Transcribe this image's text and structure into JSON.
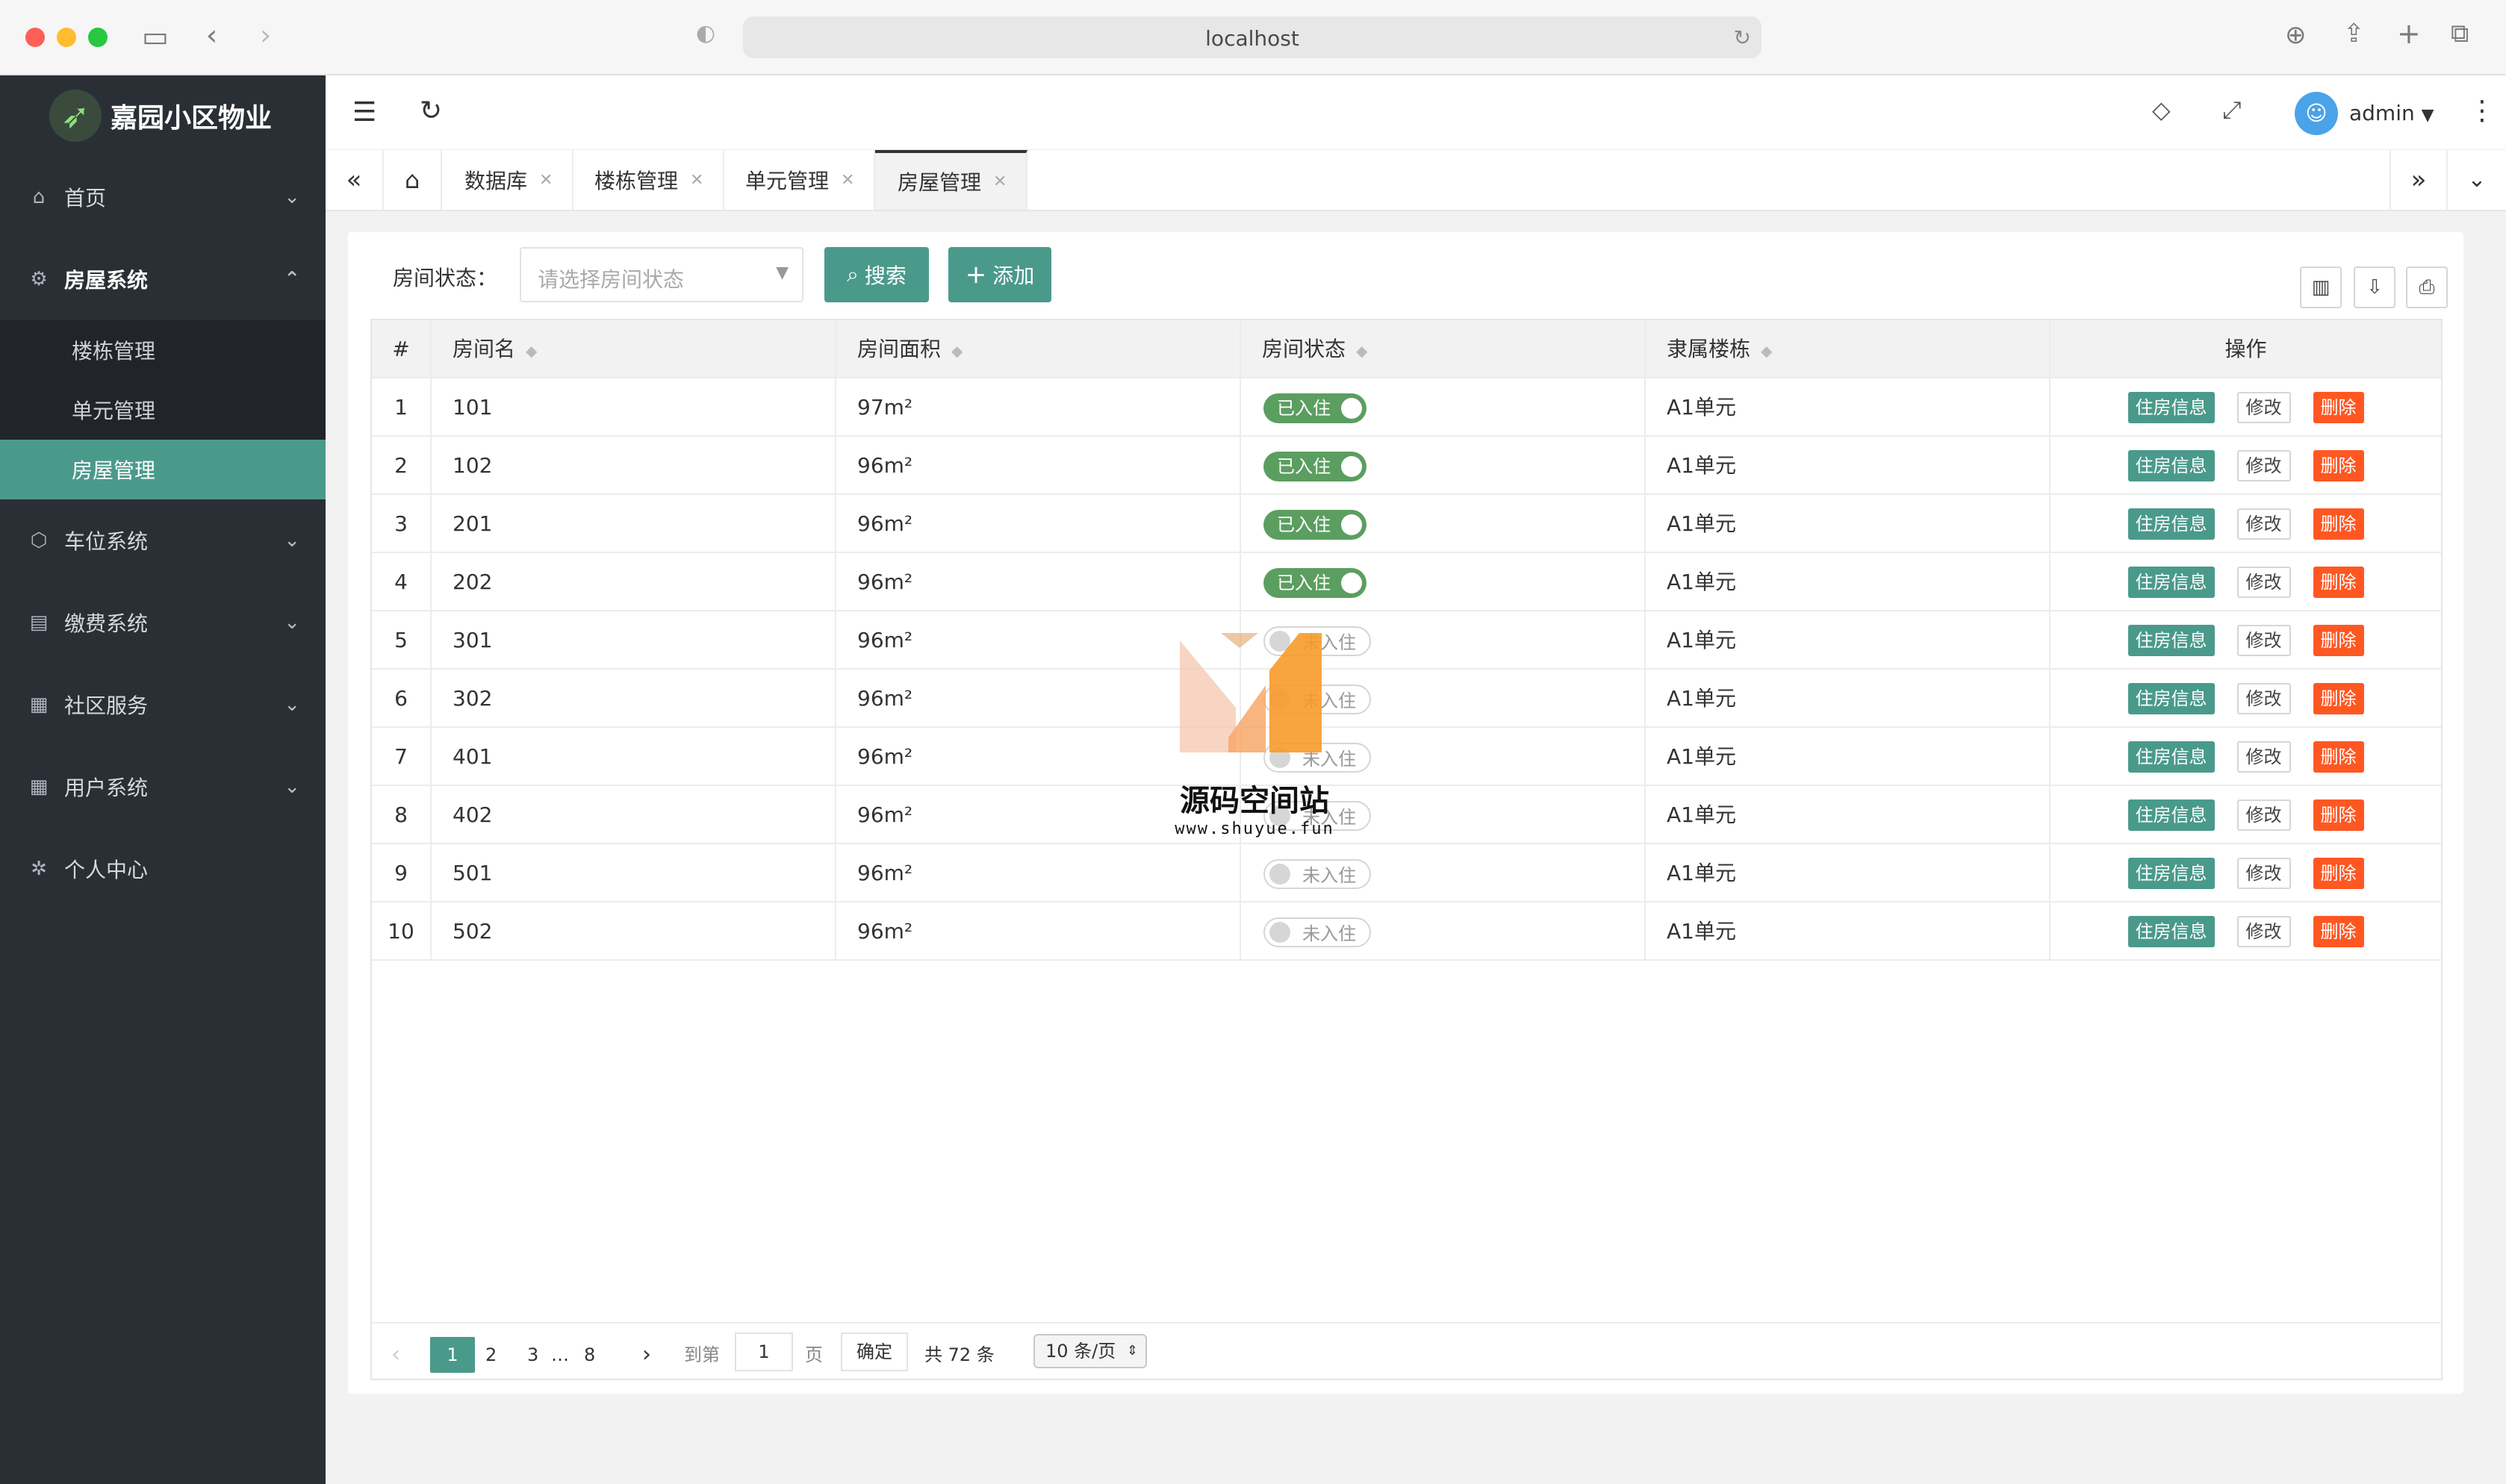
{
  "browser": {
    "url": "localhost"
  },
  "app": {
    "title": "嘉园小区物业"
  },
  "sidebar": {
    "items": [
      {
        "label": "首页"
      },
      {
        "label": "房屋系统"
      },
      {
        "label": "车位系统"
      },
      {
        "label": "缴费系统"
      },
      {
        "label": "社区服务"
      },
      {
        "label": "用户系统"
      },
      {
        "label": "个人中心"
      }
    ],
    "sub_items": [
      {
        "label": "楼栋管理"
      },
      {
        "label": "单元管理"
      },
      {
        "label": "房屋管理"
      }
    ]
  },
  "header": {
    "user": "admin"
  },
  "tabs": [
    {
      "label": "数据库"
    },
    {
      "label": "楼栋管理"
    },
    {
      "label": "单元管理"
    },
    {
      "label": "房屋管理"
    }
  ],
  "filter": {
    "label": "房间状态：",
    "placeholder": "请选择房间状态",
    "search_label": "搜索",
    "add_label": "添加"
  },
  "table": {
    "headers": [
      "#",
      "房间名",
      "房间面积",
      "房间状态",
      "隶属楼栋",
      "操作"
    ],
    "rows": [
      {
        "no": "1",
        "name": "101",
        "area": "97m²",
        "status": "已入住",
        "unit": "A1单元"
      },
      {
        "no": "2",
        "name": "102",
        "area": "96m²",
        "status": "已入住",
        "unit": "A1单元"
      },
      {
        "no": "3",
        "name": "201",
        "area": "96m²",
        "status": "已入住",
        "unit": "A1单元"
      },
      {
        "no": "4",
        "name": "202",
        "area": "96m²",
        "status": "已入住",
        "unit": "A1单元"
      },
      {
        "no": "5",
        "name": "301",
        "area": "96m²",
        "status": "未入住",
        "unit": "A1单元"
      },
      {
        "no": "6",
        "name": "302",
        "area": "96m²",
        "status": "未入住",
        "unit": "A1单元"
      },
      {
        "no": "7",
        "name": "401",
        "area": "96m²",
        "status": "未入住",
        "unit": "A1单元"
      },
      {
        "no": "8",
        "name": "402",
        "area": "96m²",
        "status": "未入住",
        "unit": "A1单元"
      },
      {
        "no": "9",
        "name": "501",
        "area": "96m²",
        "status": "未入住",
        "unit": "A1单元"
      },
      {
        "no": "10",
        "name": "502",
        "area": "96m²",
        "status": "未入住",
        "unit": "A1单元"
      }
    ],
    "ops": {
      "info": "住房信息",
      "edit": "修改",
      "del": "删除"
    }
  },
  "pager": {
    "pages": [
      "1",
      "2",
      "3",
      "…",
      "8"
    ],
    "goto_label": "到第",
    "goto_value": "1",
    "page_unit": "页",
    "confirm": "确定",
    "total": "共 72 条",
    "page_size": "10 条/页"
  },
  "watermark": {
    "title": "源码空间站",
    "url": "www.shuyue.fun"
  }
}
